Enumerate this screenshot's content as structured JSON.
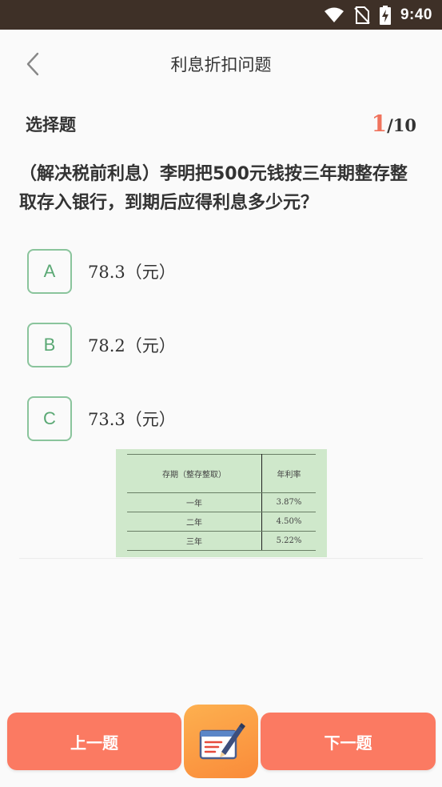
{
  "status": {
    "time": "9:40"
  },
  "nav": {
    "title": "利息折扣问题"
  },
  "question": {
    "type": "选择题",
    "current": "1",
    "total": "/10",
    "text": "（解决税前利息）李明把500元钱按三年期整存整取存入银行，到期后应得利息多少元？"
  },
  "options": [
    {
      "letter": "A",
      "text": "78.3（元）"
    },
    {
      "letter": "B",
      "text": "78.2（元）"
    },
    {
      "letter": "C",
      "text": "73.3（元）"
    }
  ],
  "rate_table": {
    "headers": [
      "存期（整存整取）",
      "年利率"
    ],
    "rows": [
      [
        "一年",
        "3.87%"
      ],
      [
        "二年",
        "4.50%"
      ],
      [
        "三年",
        "5.22%"
      ]
    ]
  },
  "bottom": {
    "prev_label": "上一题",
    "next_label": "下一题"
  },
  "icons": {
    "back": "chevron-left-icon",
    "draft": "notepad-pen-icon",
    "wifi": "wifi-icon",
    "no_sim": "no-sim-icon",
    "battery": "battery-charging-icon"
  },
  "colors": {
    "accent": "#fb7a62",
    "progress": "#f0735d",
    "option_border": "#8ac49c",
    "table_bg": "#cfe8cb",
    "status_bar": "#3e3027"
  }
}
